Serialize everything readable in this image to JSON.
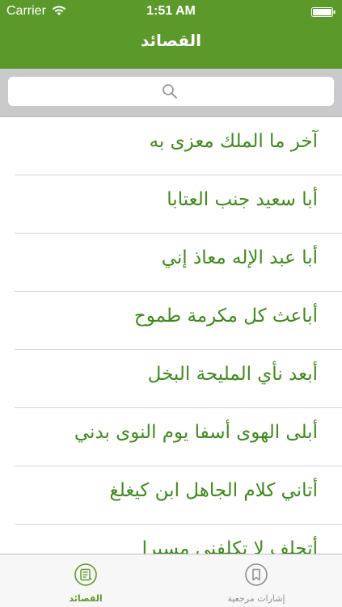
{
  "status_bar": {
    "carrier": "Carrier",
    "time": "1:51 AM"
  },
  "nav": {
    "title": "القصائد"
  },
  "search": {
    "placeholder": ""
  },
  "list": {
    "items": [
      "آخر ما الملك معزى به",
      "أبا سعيد جنب العتابا",
      "أبا عبد الإله معاذ إني",
      "أباعث كل مكرمة طموح",
      "أبعد نأي المليحة البخل",
      "أبلى الهوى أسفا يوم النوى بدني",
      "أتاني كلام الجاهل ابن كيغلغ",
      "أتحلف لا تكلفني مسيرا"
    ]
  },
  "tab_bar": {
    "tabs": [
      {
        "label": "القصائد",
        "icon": "scroll-icon",
        "selected": true
      },
      {
        "label": "إشارات مرجعية",
        "icon": "bookmark-icon",
        "selected": false
      }
    ]
  },
  "colors": {
    "accent": "#5b9a2a",
    "text_green": "#3f8a1c",
    "search_background": "#c9c9ce",
    "tab_inactive": "#8e8e93"
  }
}
